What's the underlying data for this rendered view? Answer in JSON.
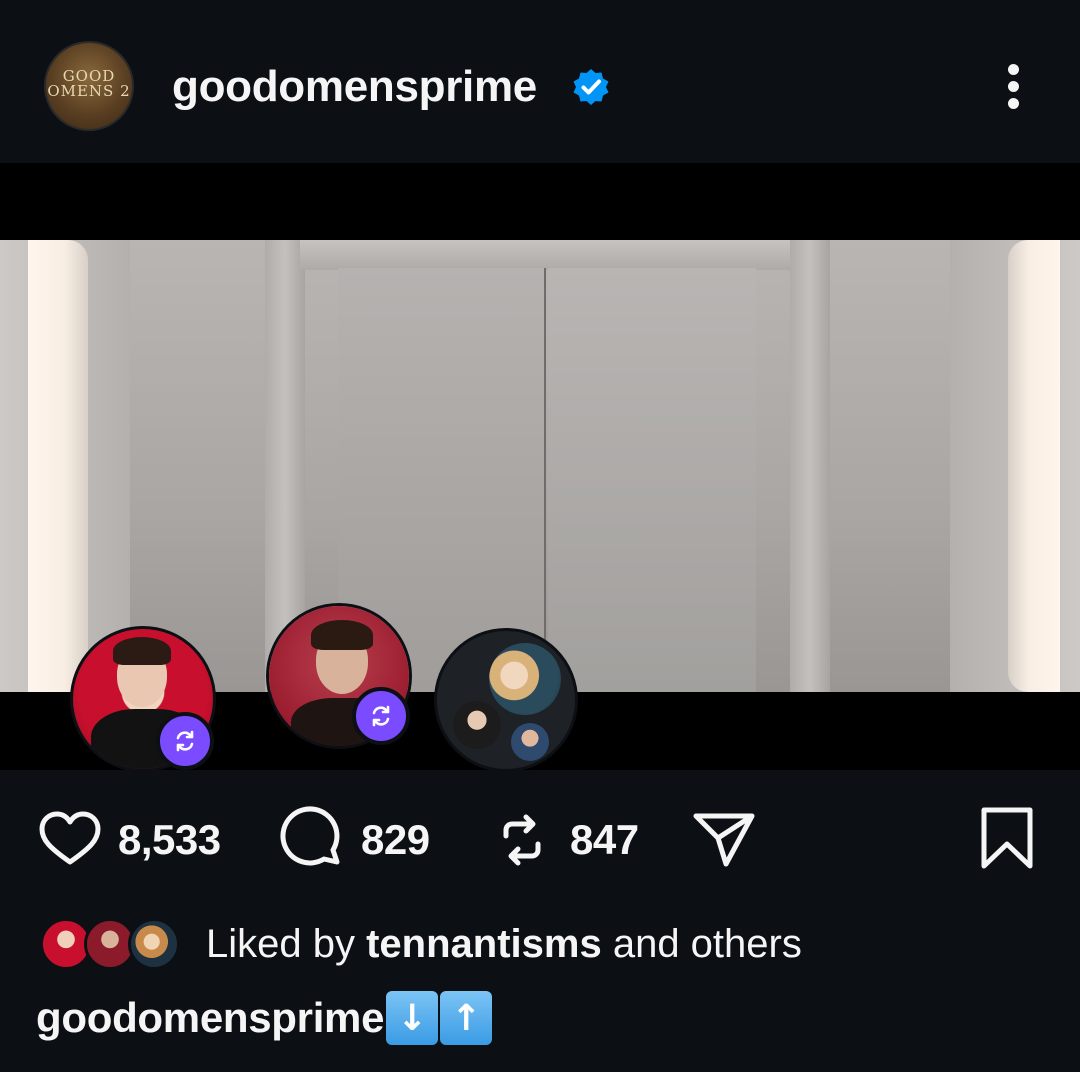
{
  "header": {
    "username": "goodomensprime",
    "avatar_logo_text": "GOOD OMENS 2",
    "verified": true,
    "more_icon": "more-vertical-icon"
  },
  "media": {
    "type": "video",
    "stories": [
      {
        "name": "story-avatar-1",
        "reposted": true
      },
      {
        "name": "story-avatar-2",
        "reposted": true
      },
      {
        "name": "story-avatar-group",
        "reposted": false
      }
    ],
    "repost_badge_color": "#7b4cff"
  },
  "actions": {
    "likes": "8,533",
    "comments": "829",
    "reposts": "847",
    "icons": [
      "heart-icon",
      "comment-icon",
      "repost-icon",
      "share-icon",
      "bookmark-icon"
    ]
  },
  "liked_by": {
    "prefix": "Liked by ",
    "user": "tennantisms",
    "suffix": " and others"
  },
  "caption": {
    "username": "goodomensprime",
    "emoji": [
      "↓",
      "↑"
    ]
  },
  "colors": {
    "background": "#0c1014",
    "text": "#f5f5f5",
    "verified_blue": "#0095f6"
  }
}
